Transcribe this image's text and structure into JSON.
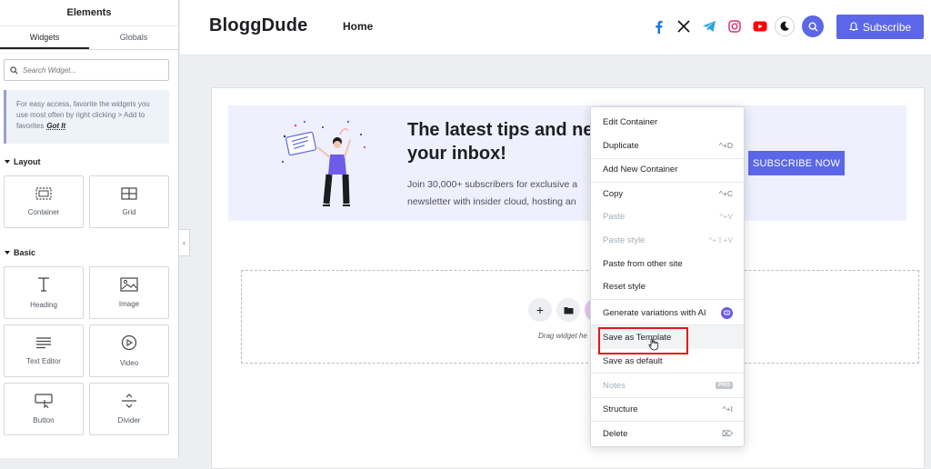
{
  "panel": {
    "title": "Elements",
    "tabs": [
      "Widgets",
      "Globals"
    ],
    "search_placeholder": "Search Widget...",
    "notice_text": "For easy access, favorite the widgets you use most often by right clicking > Add to favorites",
    "notice_link": "Got It",
    "categories": [
      {
        "name": "Layout",
        "widgets": [
          {
            "label": "Container",
            "icon": "container-icon"
          },
          {
            "label": "Grid",
            "icon": "grid-icon"
          }
        ]
      },
      {
        "name": "Basic",
        "widgets": [
          {
            "label": "Heading",
            "icon": "heading-icon"
          },
          {
            "label": "Image",
            "icon": "image-icon"
          },
          {
            "label": "Text Editor",
            "icon": "text-editor-icon"
          },
          {
            "label": "Video",
            "icon": "video-icon"
          },
          {
            "label": "Button",
            "icon": "button-icon"
          },
          {
            "label": "Divider",
            "icon": "divider-icon"
          }
        ]
      }
    ]
  },
  "header": {
    "logo": "BloggDude",
    "nav_home": "Home",
    "social_icons": [
      "facebook-icon",
      "x-icon",
      "telegram-icon",
      "instagram-icon",
      "youtube-icon"
    ],
    "subscribe_label": "Subscribe",
    "accent": "#5b67e8"
  },
  "hero": {
    "title_line1": "The latest tips and ne",
    "title_line2": "your inbox!",
    "text_line1": "Join 30,000+ subscribers for exclusive a",
    "text_line2": "newsletter with insider cloud, hosting an",
    "button": "SUBSCRIBE NOW"
  },
  "dropzone": {
    "text": "Drag widget he"
  },
  "context_menu": {
    "items": [
      {
        "label": "Edit Container",
        "shortcut": ""
      },
      {
        "label": "Duplicate",
        "shortcut": "^+D"
      },
      {
        "label": "Add New Container",
        "shortcut": ""
      },
      {
        "label": "Copy",
        "shortcut": "^+C"
      },
      {
        "label": "Paste",
        "shortcut": "^+V",
        "disabled": true
      },
      {
        "label": "Paste style",
        "shortcut": "^+⇧+V",
        "disabled": true
      },
      {
        "label": "Paste from other site",
        "shortcut": ""
      },
      {
        "label": "Reset style",
        "shortcut": ""
      },
      {
        "label": "Generate variations with AI",
        "shortcut": ""
      },
      {
        "label": "Save as Template",
        "shortcut": "",
        "highlighted": true
      },
      {
        "label": "Save as default",
        "shortcut": ""
      },
      {
        "label": "Notes",
        "shortcut": "PRO",
        "disabled": true
      },
      {
        "label": "Structure",
        "shortcut": "^+I"
      },
      {
        "label": "Delete",
        "shortcut": "⌦"
      }
    ]
  }
}
